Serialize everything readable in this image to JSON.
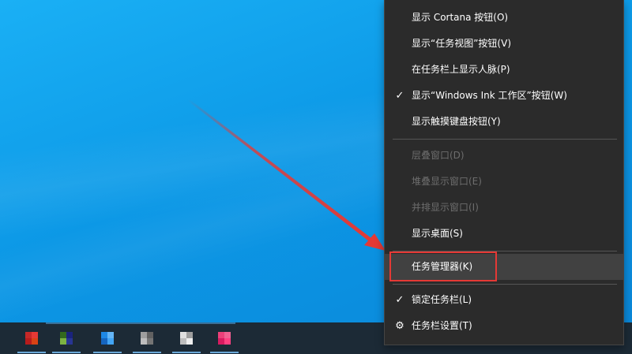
{
  "menu": {
    "items": [
      {
        "label": "显示 Cortana 按钮(O)",
        "checked": false,
        "disabled": false
      },
      {
        "label": "显示“任务视图”按钮(V)",
        "checked": false,
        "disabled": false
      },
      {
        "label": "在任务栏上显示人脉(P)",
        "checked": false,
        "disabled": false
      },
      {
        "label": "显示“Windows Ink 工作区”按钮(W)",
        "checked": true,
        "disabled": false
      },
      {
        "label": "显示触摸键盘按钮(Y)",
        "checked": false,
        "disabled": false
      },
      {
        "label": "层叠窗口(D)",
        "checked": false,
        "disabled": true
      },
      {
        "label": "堆叠显示窗口(E)",
        "checked": false,
        "disabled": true
      },
      {
        "label": "并排显示窗口(I)",
        "checked": false,
        "disabled": true
      },
      {
        "label": "显示桌面(S)",
        "checked": false,
        "disabled": false
      },
      {
        "label": "任务管理器(K)",
        "checked": false,
        "disabled": false,
        "highlighted": true
      },
      {
        "label": "锁定任务栏(L)",
        "checked": true,
        "disabled": false
      },
      {
        "label": "任务栏设置(T)",
        "checked": false,
        "disabled": false,
        "icon": "gear-icon"
      }
    ],
    "check_glyph": "✓",
    "gear_glyph": "⚙"
  },
  "colors": {
    "menu_background": "#2b2b2b",
    "menu_text": "#ffffff",
    "menu_disabled_text": "#6d6d6d",
    "menu_hover": "#414141",
    "annotation_red": "#e53935",
    "desktop_blue": "#0c98e6",
    "taskbar": "#1c2a36"
  },
  "taskbar": {
    "icons": [
      {
        "name": "red-app-icon",
        "colors": [
          "#c62828",
          "#e53935",
          "#b71c1c",
          "#d84315"
        ]
      },
      {
        "name": "green-app-icon",
        "colors": [
          "#33691e",
          "#1a237e",
          "#7cb342",
          "#283593"
        ]
      },
      {
        "name": "blue-app-icon",
        "colors": [
          "#1e88e5",
          "#64b5f6",
          "#1565c0",
          "#42a5f5"
        ]
      },
      {
        "name": "gray-app-icon-1",
        "colors": [
          "#9e9e9e",
          "#616161",
          "#bdbdbd",
          "#757575"
        ]
      },
      {
        "name": "gray-app-icon-2",
        "colors": [
          "#e0e0e0",
          "#9e9e9e",
          "#bdbdbd",
          "#eeeeee"
        ]
      },
      {
        "name": "pink-app-icon",
        "colors": [
          "#ec407a",
          "#f06292",
          "#d81b60",
          "#ff4081"
        ]
      }
    ]
  }
}
